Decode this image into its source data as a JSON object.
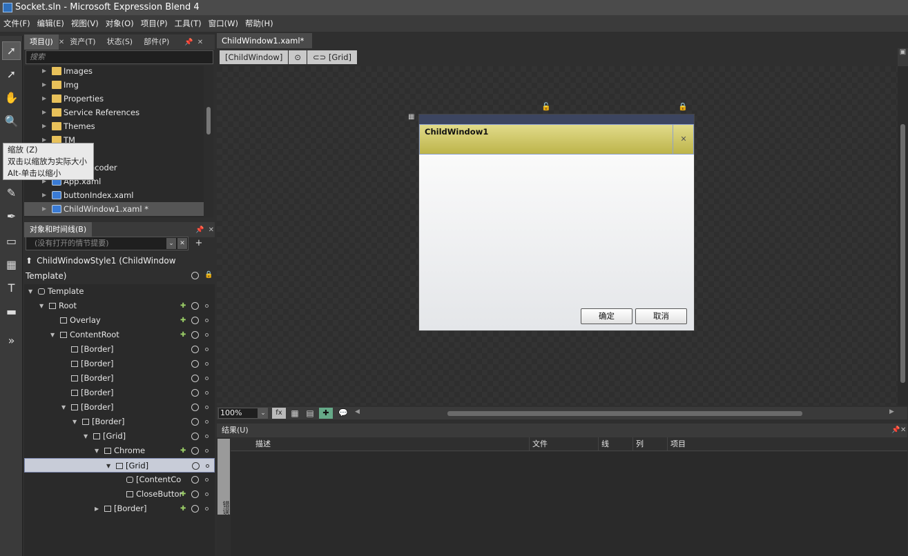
{
  "window": {
    "title": "Socket.sln - Microsoft Expression Blend 4"
  },
  "menu": [
    "文件(F)",
    "编辑(E)",
    "视图(V)",
    "对象(O)",
    "项目(P)",
    "工具(T)",
    "窗口(W)",
    "帮助(H)"
  ],
  "tooltip": {
    "line1": "缩放 (Z)",
    "line2": "双击以缩放为实际大小",
    "line3": "Alt-单击以缩小"
  },
  "project_panel": {
    "tabs": [
      "项目(J)",
      "资产(T)",
      "状态(S)",
      "部件(P)"
    ],
    "search_placeholder": "搜索",
    "items": [
      {
        "label": "Images",
        "type": "folder"
      },
      {
        "label": "Img",
        "type": "folder"
      },
      {
        "label": "Properties",
        "type": "folder"
      },
      {
        "label": "Service References",
        "type": "folder"
      },
      {
        "label": "Themes",
        "type": "folder"
      },
      {
        "label": "TM",
        "type": "folder"
      },
      {
        "label": "upload",
        "type": "folder"
      },
      {
        "label": "VoiceEncoder",
        "type": "folder"
      },
      {
        "label": "App.xaml",
        "type": "xaml"
      },
      {
        "label": "buttonIndex.xaml",
        "type": "xaml"
      },
      {
        "label": "ChildWindow1.xaml *",
        "type": "xaml",
        "selected": true
      }
    ]
  },
  "objects_panel": {
    "title": "对象和时间线(B)",
    "storyboard_filter": "(没有打开的情节提要)",
    "scope": "ChildWindowStyle1 (ChildWindow Template)",
    "tree": [
      {
        "label": "Template",
        "depth": 0,
        "expanded": true
      },
      {
        "label": "Root",
        "depth": 1,
        "expanded": true
      },
      {
        "label": "Overlay",
        "depth": 2
      },
      {
        "label": "ContentRoot",
        "depth": 2,
        "expanded": true
      },
      {
        "label": "[Border]",
        "depth": 3
      },
      {
        "label": "[Border]",
        "depth": 3
      },
      {
        "label": "[Border]",
        "depth": 3
      },
      {
        "label": "[Border]",
        "depth": 3
      },
      {
        "label": "[Border]",
        "depth": 3,
        "expanded": true
      },
      {
        "label": "[Border]",
        "depth": 4,
        "expanded": true
      },
      {
        "label": "[Grid]",
        "depth": 5,
        "expanded": true
      },
      {
        "label": "Chrome",
        "depth": 6,
        "expanded": true
      },
      {
        "label": "[Grid]",
        "depth": 7,
        "expanded": true,
        "selected": true
      },
      {
        "label": "[ContentCo",
        "depth": 8
      },
      {
        "label": "CloseButtor",
        "depth": 8
      },
      {
        "label": "[Border]",
        "depth": 6,
        "collapsed": true
      }
    ]
  },
  "document": {
    "tab": "ChildWindow1.xaml*",
    "breadcrumb": [
      "[ChildWindow]",
      "",
      "[Grid]"
    ],
    "zoom": "100%"
  },
  "child_window": {
    "title": "ChildWindow1",
    "ok": "确定",
    "cancel": "取消"
  },
  "results_panel": {
    "title": "结果(U)",
    "columns": [
      "描述",
      "文件",
      "线",
      "列",
      "项目"
    ],
    "side_tab": "错误"
  }
}
